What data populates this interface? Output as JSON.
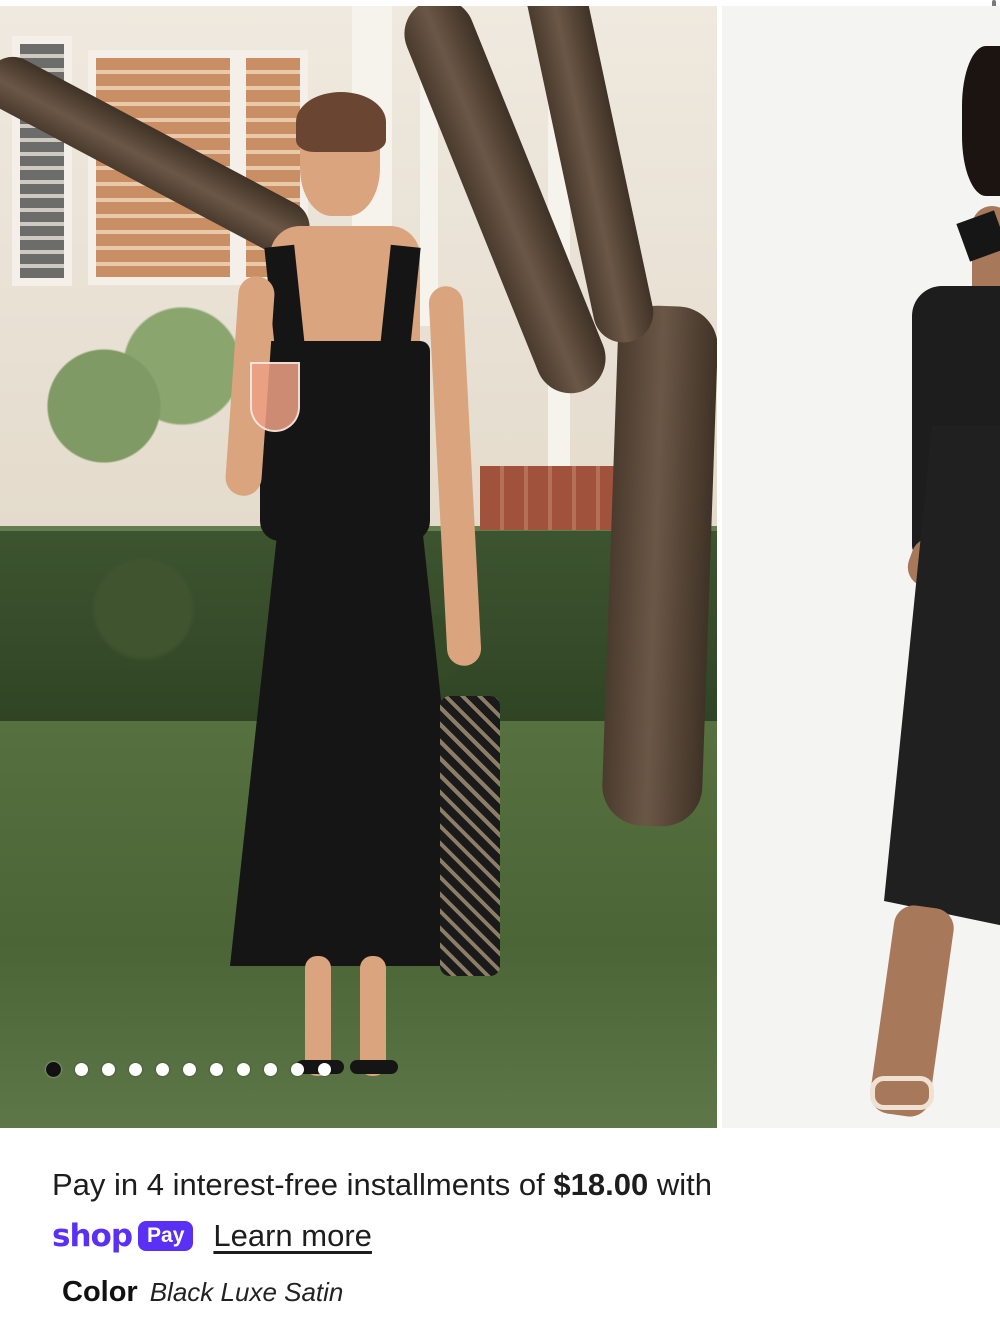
{
  "gallery": {
    "slide_count": 11,
    "active_index": 0
  },
  "installments": {
    "prefix": "Pay in 4 interest-free installments of",
    "amount": "$18.00",
    "suffix": "with"
  },
  "shop_pay": {
    "brand": "shop",
    "badge": "Pay",
    "learn_more": "Learn more",
    "brand_color": "#5a31f4"
  },
  "color": {
    "label": "Color",
    "value": "Black Luxe Satin"
  }
}
